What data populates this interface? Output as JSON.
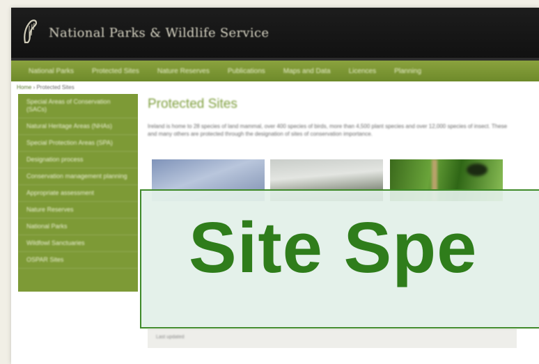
{
  "header": {
    "site_title": "National Parks & Wildlife Service",
    "logo_icon": "harp-icon",
    "background": "#151515"
  },
  "nav": {
    "items": [
      "National Parks",
      "Protected Sites",
      "Nature Reserves",
      "Publications",
      "Maps and Data",
      "Licences",
      "Planning"
    ],
    "accent": "#7d9a36"
  },
  "breadcrumb": {
    "home": "Home",
    "current": "Protected Sites"
  },
  "sidebar": {
    "items": [
      "Special Areas of Conservation (SACs)",
      "Natural Heritage Areas (NHAs)",
      "Special Protection Areas (SPA)",
      "Designation process",
      "Conservation management planning",
      "Appropriate assessment",
      "Nature Reserves",
      "National Parks",
      "Wildfowl Sanctuaries",
      "OSPAR Sites"
    ]
  },
  "main": {
    "title": "Protected Sites",
    "intro": "Ireland is home to 28 species of land mammal, over 400 species of birds, more than 4,500 plant species and over 12,000 species of insect. These and many others are protected through the designation of sites of conservation importance."
  },
  "footer": {
    "text": "Last updated"
  },
  "overlay": {
    "text": "Site Spe",
    "color": "#2f7d1b",
    "background": "#e2f0e8"
  }
}
